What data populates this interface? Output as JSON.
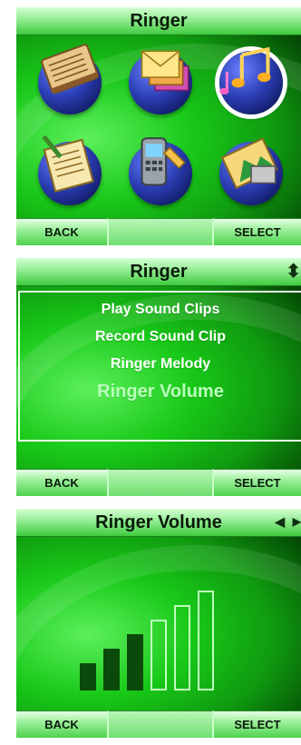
{
  "screen1": {
    "title": "Ringer",
    "icons": [
      "address-book-icon",
      "messages-icon",
      "music-notes-icon",
      "notepad-icon",
      "phone-settings-icon",
      "pictures-icon"
    ],
    "selected_icon_index": 2,
    "back_label": "BACK",
    "select_label": "SELECT"
  },
  "screen2": {
    "title": "Ringer",
    "scroll_indicator": "⬍",
    "menu": [
      "Play Sound Clips",
      "Record Sound Clip",
      "Ringer Melody",
      "Ringer Volume"
    ],
    "highlighted_index": 3,
    "back_label": "BACK",
    "select_label": "SELECT"
  },
  "screen3": {
    "title": "Ringer Volume",
    "arrow_left": "◀",
    "arrow_right": "▶",
    "volume": {
      "level": 3,
      "max": 6
    },
    "back_label": "BACK",
    "select_label": "SELECT"
  },
  "colors": {
    "bar_on": "#0a4a0a",
    "bar_off_outline": "#bfffbf",
    "selected_ring": "#ffffff"
  }
}
